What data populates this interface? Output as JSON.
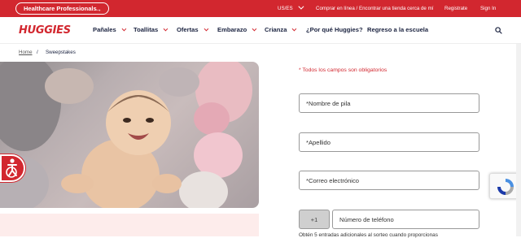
{
  "topbar": {
    "hcp_label": "Healthcare Professionals",
    "locale": "US/ES",
    "buy_link": "Comprar en línea / Encontrar una tienda cerca de mí",
    "register": "Registrate",
    "sign_in": "Sign In"
  },
  "nav": {
    "logo": "HUGGIES",
    "items": [
      "Pañales",
      "Toallitas",
      "Ofertas",
      "Embarazo",
      "Crianza",
      "¿Por qué Huggies?",
      "Regreso a la escuela"
    ]
  },
  "breadcrumb": {
    "home": "Home",
    "separator": "/",
    "current": "Sweepstakes"
  },
  "form": {
    "required_note": "* Todos los campos son obligatorios",
    "first_name": "*Nombre de pila",
    "last_name": "*Apellido",
    "email": "*Correo electrónico",
    "phone_prefix": "+1",
    "phone": "Número de teléfono",
    "bottom_note": "Obtén 5 entradas adicionales al sorteo cuando proporcionas"
  },
  "colors": {
    "brand_red": "#d2272f",
    "navy": "#1b2340"
  },
  "icons": [
    "arrow-right-icon",
    "chevron-down-icon",
    "search-icon",
    "accessibility-icon",
    "recaptcha-icon"
  ]
}
